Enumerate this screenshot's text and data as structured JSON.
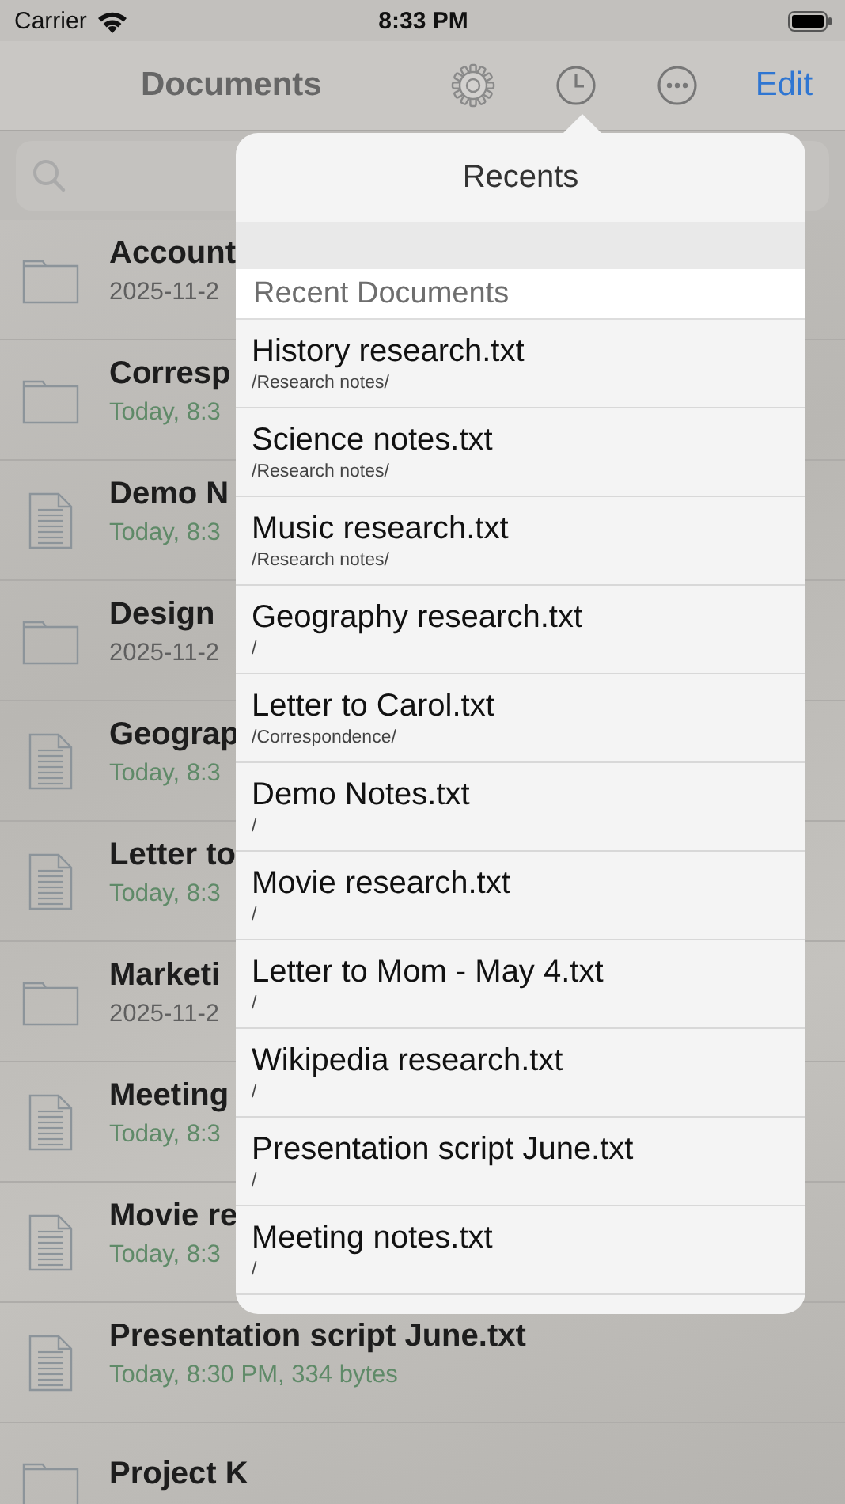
{
  "status_bar": {
    "carrier": "Carrier",
    "time": "8:33 PM"
  },
  "nav": {
    "title": "Documents",
    "edit": "Edit"
  },
  "files": [
    {
      "kind": "folder",
      "name": "Account",
      "detail": "2025-11-2",
      "color": "#5f5f5f"
    },
    {
      "kind": "folder",
      "name": "Corresp",
      "detail": "Today, 8:3",
      "color": "#5f8a68"
    },
    {
      "kind": "document",
      "name": "Demo N",
      "detail": "Today, 8:3",
      "color": "#5f8a68"
    },
    {
      "kind": "folder",
      "name": "Design",
      "detail": "2025-11-2",
      "color": "#5f5f5f"
    },
    {
      "kind": "document",
      "name": "Geograp",
      "detail": "Today, 8:3",
      "color": "#5f8a68"
    },
    {
      "kind": "document",
      "name": "Letter to",
      "detail": "Today, 8:3",
      "color": "#5f8a68"
    },
    {
      "kind": "folder",
      "name": "Marketi",
      "detail": "2025-11-2",
      "color": "#5f5f5f"
    },
    {
      "kind": "document",
      "name": "Meeting",
      "detail": "Today, 8:3",
      "color": "#5f8a68"
    },
    {
      "kind": "document",
      "name": "Movie re",
      "detail": "Today, 8:3",
      "color": "#5f8a68"
    },
    {
      "kind": "document",
      "name": "Presentation script June.txt",
      "detail": "Today, 8:30 PM, 334 bytes",
      "color": "#5f8a68"
    },
    {
      "kind": "folder",
      "name": "Project K"
    }
  ],
  "popover": {
    "title": "Recents",
    "section": "Recent Documents",
    "items": [
      {
        "name": "History research.txt",
        "path": "/Research notes/"
      },
      {
        "name": "Science notes.txt",
        "path": "/Research notes/"
      },
      {
        "name": "Music research.txt",
        "path": "/Research notes/"
      },
      {
        "name": "Geography research.txt",
        "path": "/"
      },
      {
        "name": "Letter to Carol.txt",
        "path": "/Correspondence/"
      },
      {
        "name": "Demo Notes.txt",
        "path": "/"
      },
      {
        "name": "Movie research.txt",
        "path": "/"
      },
      {
        "name": "Letter to Mom - May 4.txt",
        "path": "/"
      },
      {
        "name": "Wikipedia research.txt",
        "path": "/"
      },
      {
        "name": "Presentation script June.txt",
        "path": "/"
      },
      {
        "name": "Meeting notes.txt",
        "path": "/"
      }
    ]
  }
}
